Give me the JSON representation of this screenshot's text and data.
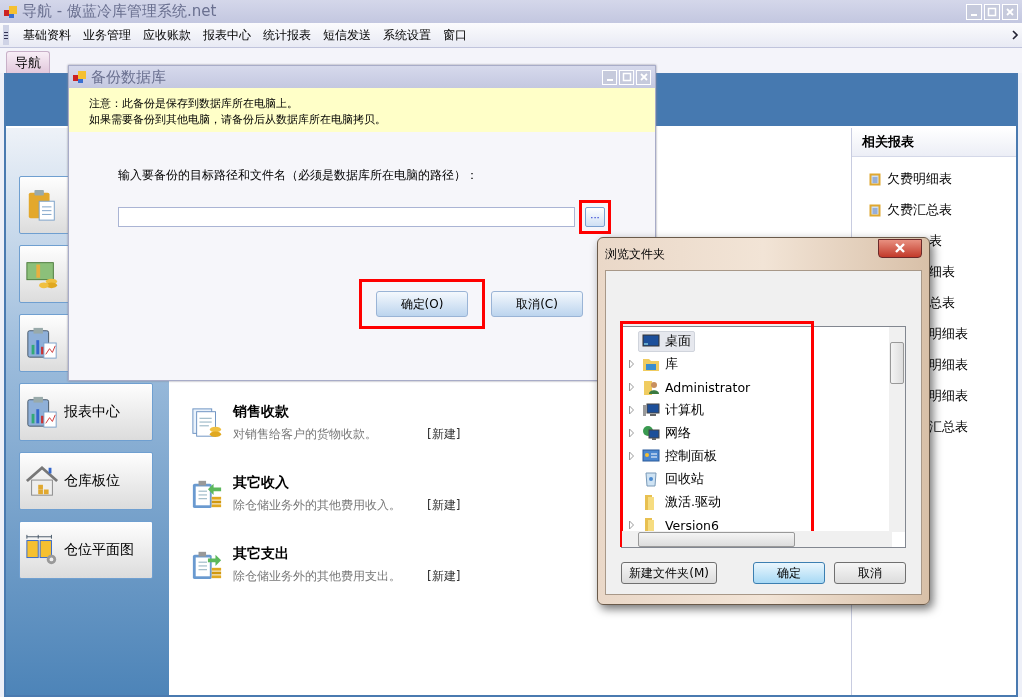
{
  "window": {
    "title": "导航 - 傲蓝冷库管理系统.net",
    "active": false
  },
  "menu": [
    "基础资料",
    "业务管理",
    "应收账款",
    "报表中心",
    "统计报表",
    "短信发送",
    "系统设置",
    "窗口"
  ],
  "tabs": [
    {
      "label": "导航",
      "selected": true
    }
  ],
  "sidebar": {
    "buttons": [
      {
        "kind": "covered"
      },
      {
        "kind": "covered"
      },
      {
        "kind": "covered"
      },
      {
        "kind": "labeled",
        "label": "报表中心"
      },
      {
        "kind": "labeled",
        "label": "仓库板位"
      },
      {
        "kind": "labeled",
        "label": "仓位平面图"
      }
    ]
  },
  "tasks": [
    {
      "title": "销售收款",
      "description": "对销售给客户的货物收款。",
      "link": "[新建]"
    },
    {
      "title": "其它收入",
      "description": "除仓储业务外的其他费用收入。",
      "link": "[新建]"
    },
    {
      "title": "其它支出",
      "description": "除仓储业务外的其他费用支出。",
      "link": "[新建]"
    }
  ],
  "related_reports": {
    "title": "相关报表",
    "items": [
      {
        "label": "欠费明细表",
        "kind": "full"
      },
      {
        "label": "欠费汇总表",
        "kind": "full"
      },
      {
        "label": "表",
        "kind": "cut"
      },
      {
        "label": "细表",
        "kind": "cut"
      },
      {
        "label": "总表",
        "kind": "cut"
      },
      {
        "label": "明细表",
        "kind": "cut"
      },
      {
        "label": "明细表",
        "kind": "cut"
      },
      {
        "label": "明细表",
        "kind": "cut"
      },
      {
        "label": "汇总表",
        "kind": "cut"
      }
    ]
  },
  "backup_dialog": {
    "title": "备份数据库",
    "notice": [
      "注意：此备份是保存到数据库所在电脑上。",
      "如果需要备份到其他电脑，请备份后从数据库所在电脑拷贝。"
    ],
    "path_label": "输入要备份的目标路径和文件名（必须是数据库所在电脑的路径）：",
    "browse_button": "···",
    "ok_button": "确定(O)",
    "cancel_button": "取消(C)"
  },
  "browse_dialog": {
    "title": "浏览文件夹",
    "tree": [
      {
        "label": "桌面",
        "expandable": false,
        "selected": true,
        "children": [
          {
            "label": "库",
            "expandable": true,
            "selected": false
          },
          {
            "label": "Administrator",
            "expandable": true,
            "selected": false
          },
          {
            "label": "计算机",
            "expandable": true,
            "selected": false
          },
          {
            "label": "网络",
            "expandable": true,
            "selected": false
          },
          {
            "label": "控制面板",
            "expandable": true,
            "selected": false
          },
          {
            "label": "回收站",
            "expandable": false,
            "selected": false
          },
          {
            "label": "激活.驱动",
            "expandable": false,
            "selected": false
          },
          {
            "label": "Version6",
            "expandable": true,
            "selected": false
          }
        ]
      }
    ],
    "new_folder_button": "新建文件夹(M)",
    "ok_button": "确定",
    "cancel_button": "取消"
  }
}
